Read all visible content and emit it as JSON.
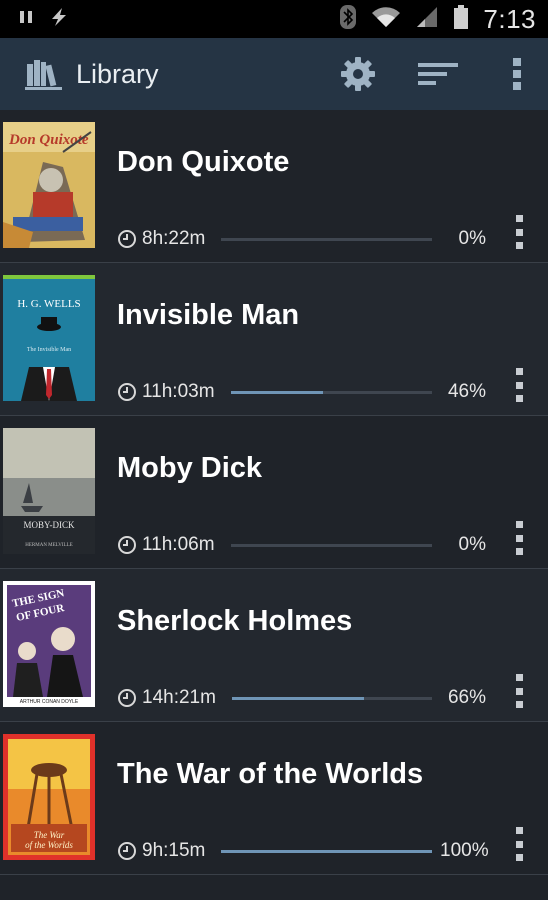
{
  "status_bar": {
    "time": "7:13",
    "icons": [
      "pause-icon",
      "flash-icon",
      "bluetooth-icon",
      "wifi-icon",
      "signal-icon",
      "battery-icon"
    ]
  },
  "app_bar": {
    "title": "Library",
    "icons": {
      "logo": "books-icon",
      "settings": "gear-icon",
      "sort": "sort-icon",
      "menu": "more-vert-icon"
    }
  },
  "books": [
    {
      "title": "Don Quixote",
      "duration": "8h:22m",
      "percent": "0%",
      "progress": 0.0
    },
    {
      "title": "Invisible Man",
      "duration": "11h:03m",
      "percent": "46%",
      "progress": 0.46
    },
    {
      "title": "Moby Dick",
      "duration": "11h:06m",
      "percent": "0%",
      "progress": 0.0
    },
    {
      "title": "Sherlock Holmes",
      "duration": "14h:21m",
      "percent": "66%",
      "progress": 0.66
    },
    {
      "title": "The War of the Worlds",
      "duration": "9h:15m",
      "percent": "100%",
      "progress": 1.0
    }
  ],
  "covers": [
    {
      "text": "Don Quixote",
      "colors": [
        "#c9a24a",
        "#b63a2a",
        "#3b5fa0"
      ]
    },
    {
      "author": "H. G. WELLS",
      "text": "The Invisible Man",
      "colors": [
        "#1f7fa0",
        "#2b8fae"
      ]
    },
    {
      "text": "MOBY-DICK",
      "subtext": "HERMAN MELVILLE",
      "colors": [
        "#b7b7a8",
        "#4a5057",
        "#22262b"
      ]
    },
    {
      "text": "THE SIGN OF FOUR",
      "subtext": "ARTHUR CONAN DOYLE",
      "colors": [
        "#5a3c7c",
        "#ffffff",
        "#1a1a1a"
      ]
    },
    {
      "text": "The War of the Worlds",
      "colors": [
        "#e0312a",
        "#e98a2b",
        "#f4c445"
      ]
    }
  ]
}
